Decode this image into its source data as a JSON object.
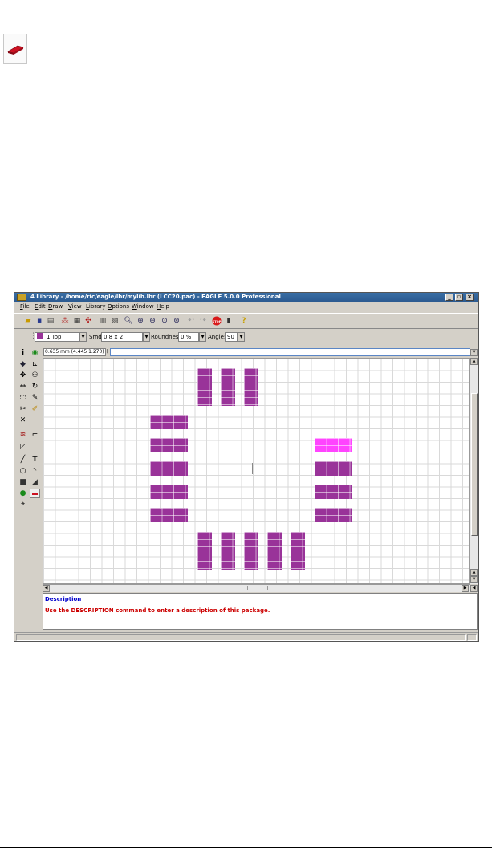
{
  "window": {
    "title": "4 Library - /home/ric/eagle/lbr/mylib.lbr (LCC20.pac) - EAGLE 5.0.0 Professional"
  },
  "menu": [
    "File",
    "Edit",
    "Draw",
    "View",
    "Library",
    "Options",
    "Window",
    "Help"
  ],
  "params": {
    "layer": "1 Top",
    "smd_label": "Smd:",
    "smd_value": "0.8 x 2",
    "roundness_label": "Roundness:",
    "roundness_value": "0 %",
    "angle_label": "Angle:",
    "angle_value": "90"
  },
  "coordinates": "0.635 mm (4.445 1.270)",
  "description": {
    "heading": "Description",
    "text": "Use the DESCRIPTION command to enter a description of this package."
  },
  "colors": {
    "pad": "#993399",
    "pad_selected": "#ff44ff",
    "titlebar": "#2b5a90"
  },
  "icons": {
    "page_icon": "smd-pad-icon",
    "toolbar": [
      "open-icon",
      "save-icon",
      "print-icon",
      "cam-icon",
      "script-icon",
      "run-icon",
      "board-icon",
      "schematic-icon",
      "zoom-fit-icon",
      "zoom-in-icon",
      "zoom-out-icon",
      "zoom-redraw-icon",
      "zoom-select-icon",
      "undo-icon",
      "redo-icon",
      "stop-icon",
      "go-icon",
      "help-icon"
    ]
  }
}
